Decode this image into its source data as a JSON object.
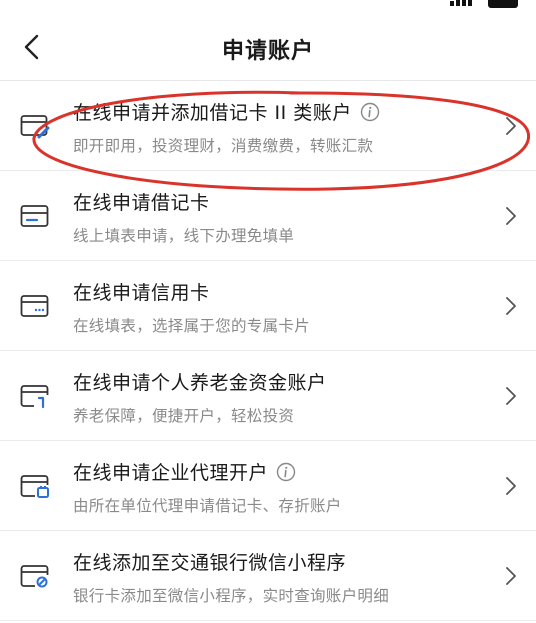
{
  "header": {
    "title": "申请账户",
    "back_icon": "chevron-left-icon"
  },
  "items": [
    {
      "title": "在线申请并添加借记卡 II 类账户",
      "subtitle": "即开即用，投资理财，消费缴费，转账汇款",
      "icon": "card-pen-icon",
      "has_info": true,
      "highlighted": true
    },
    {
      "title": "在线申请借记卡",
      "subtitle": "线上填表申请，线下办理免填单",
      "icon": "debit-card-icon",
      "has_info": false
    },
    {
      "title": "在线申请信用卡",
      "subtitle": "在线填表，选择属于您的专属卡片",
      "icon": "credit-card-icon",
      "has_info": false
    },
    {
      "title": "在线申请个人养老金资金账户",
      "subtitle": "养老保障，便捷开户，轻松投资",
      "icon": "pension-card-icon",
      "has_info": false
    },
    {
      "title": "在线申请企业代理开户",
      "subtitle": "由所在单位代理申请借记卡、存折账户",
      "icon": "enterprise-card-icon",
      "has_info": true
    },
    {
      "title": "在线添加至交通银行微信小程序",
      "subtitle": "银行卡添加至微信小程序，实时查询账户明细",
      "icon": "card-link-icon",
      "has_info": false
    }
  ],
  "colors": {
    "annotation": "#d9342b",
    "icon_stroke": "#333333",
    "icon_accent": "#2f6fd6"
  }
}
